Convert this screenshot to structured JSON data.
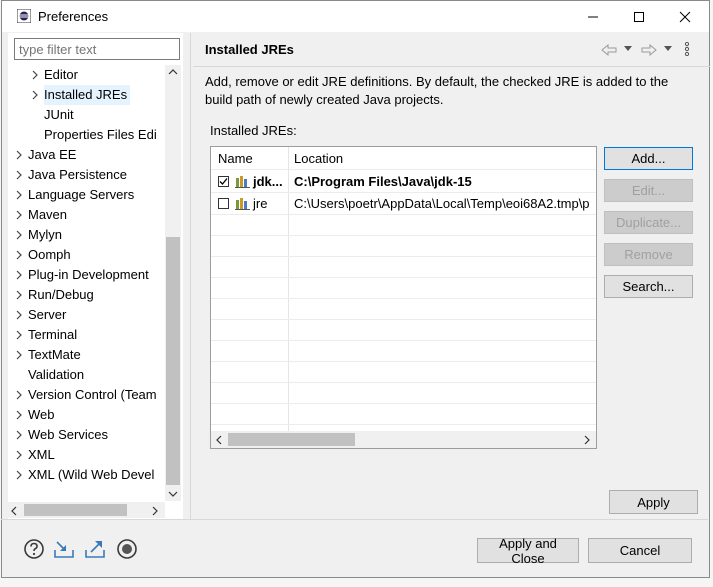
{
  "window": {
    "title": "Preferences",
    "minimize_label": "─",
    "maximize_label": "☐",
    "close_label": "✕"
  },
  "filter": {
    "placeholder": "type filter text"
  },
  "tree": {
    "items": [
      {
        "label": "Editor",
        "level": 1,
        "expandable": true
      },
      {
        "label": "Installed JREs",
        "level": 1,
        "expandable": true,
        "selected": true
      },
      {
        "label": "JUnit",
        "level": 1,
        "expandable": false
      },
      {
        "label": "Properties Files Edi",
        "level": 1,
        "expandable": false
      },
      {
        "label": "Java EE",
        "level": 0,
        "expandable": true
      },
      {
        "label": "Java Persistence",
        "level": 0,
        "expandable": true
      },
      {
        "label": "Language Servers",
        "level": 0,
        "expandable": true
      },
      {
        "label": "Maven",
        "level": 0,
        "expandable": true
      },
      {
        "label": "Mylyn",
        "level": 0,
        "expandable": true
      },
      {
        "label": "Oomph",
        "level": 0,
        "expandable": true
      },
      {
        "label": "Plug-in Development",
        "level": 0,
        "expandable": true
      },
      {
        "label": "Run/Debug",
        "level": 0,
        "expandable": true
      },
      {
        "label": "Server",
        "level": 0,
        "expandable": true
      },
      {
        "label": "Terminal",
        "level": 0,
        "expandable": true
      },
      {
        "label": "TextMate",
        "level": 0,
        "expandable": true
      },
      {
        "label": "Validation",
        "level": 0,
        "expandable": false
      },
      {
        "label": "Version Control (Team",
        "level": 0,
        "expandable": true
      },
      {
        "label": "Web",
        "level": 0,
        "expandable": true
      },
      {
        "label": "Web Services",
        "level": 0,
        "expandable": true
      },
      {
        "label": "XML",
        "level": 0,
        "expandable": true
      },
      {
        "label": "XML (Wild Web Devel",
        "level": 0,
        "expandable": true
      }
    ]
  },
  "page": {
    "title": "Installed JREs",
    "description": "Add, remove or edit JRE definitions. By default, the checked JRE is added to the build path of newly created Java projects.",
    "list_label": "Installed JREs:"
  },
  "table": {
    "columns": [
      "Name",
      "Location"
    ],
    "rows": [
      {
        "name": "jdk...",
        "location": "C:\\Program Files\\Java\\jdk-15",
        "checked": true,
        "bold": true
      },
      {
        "name": "jre",
        "location": "C:\\Users\\poetr\\AppData\\Local\\Temp\\eoi68A2.tmp\\p",
        "checked": false,
        "bold": false
      }
    ]
  },
  "buttons": {
    "add": "Add...",
    "edit": "Edit...",
    "duplicate": "Duplicate...",
    "remove": "Remove",
    "search": "Search...",
    "apply": "Apply",
    "apply_close": "Apply and Close",
    "cancel": "Cancel"
  },
  "colors": {
    "selection": "#e5f3ff",
    "accent": "#0078d7",
    "jre_icon": "#4a8a3a"
  }
}
